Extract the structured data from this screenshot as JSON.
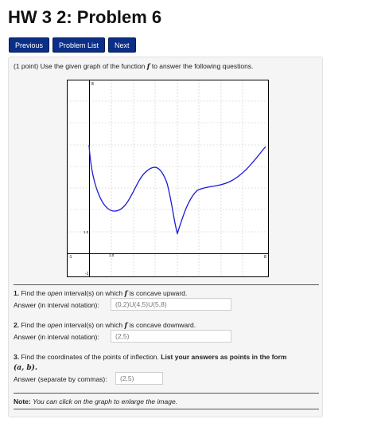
{
  "page": {
    "title": "HW 3 2: Problem 6"
  },
  "nav": {
    "previous": "Previous",
    "problem_list": "Problem List",
    "next": "Next"
  },
  "problem": {
    "points": "(1 point)",
    "intro_before": "Use the given graph of the function",
    "function_name": "f",
    "intro_after": "to answer the following questions."
  },
  "graph": {
    "tick_labels": {
      "y_top": "8",
      "y_mid": "1.0",
      "x_mid": "1.0",
      "x_left": "-1",
      "x_right": "8",
      "y_bottom": "-1"
    },
    "colors": {
      "curve": "#1a1ad6",
      "grid": "#c8c8c8",
      "axes": "#000000"
    }
  },
  "questions": [
    {
      "number": "1.",
      "text_before": "Find the",
      "emph": "open",
      "text_middle": "interval(s) on which",
      "fvar": "f",
      "text_after": "is concave upward.",
      "answer_label": "Answer (in interval notation):",
      "answer_value": "(0,2)U(4,5)U(5,8)"
    },
    {
      "number": "2.",
      "text_before": "Find the",
      "emph": "open",
      "text_middle": "interval(s) on which",
      "fvar": "f",
      "text_after": "is concave downward.",
      "answer_label": "Answer (in interval notation):",
      "answer_value": "(2,5)"
    },
    {
      "number": "3.",
      "text_plain": "Find the coordinates of the points of inflection.",
      "text_bold": "List your answers as points in the form",
      "math": "(a, b).",
      "answer_label": "Answer (separate by commas):",
      "answer_value": "(2,5)"
    }
  ],
  "note": {
    "label": "Note:",
    "text": "You can click on the graph to enlarge the image."
  }
}
